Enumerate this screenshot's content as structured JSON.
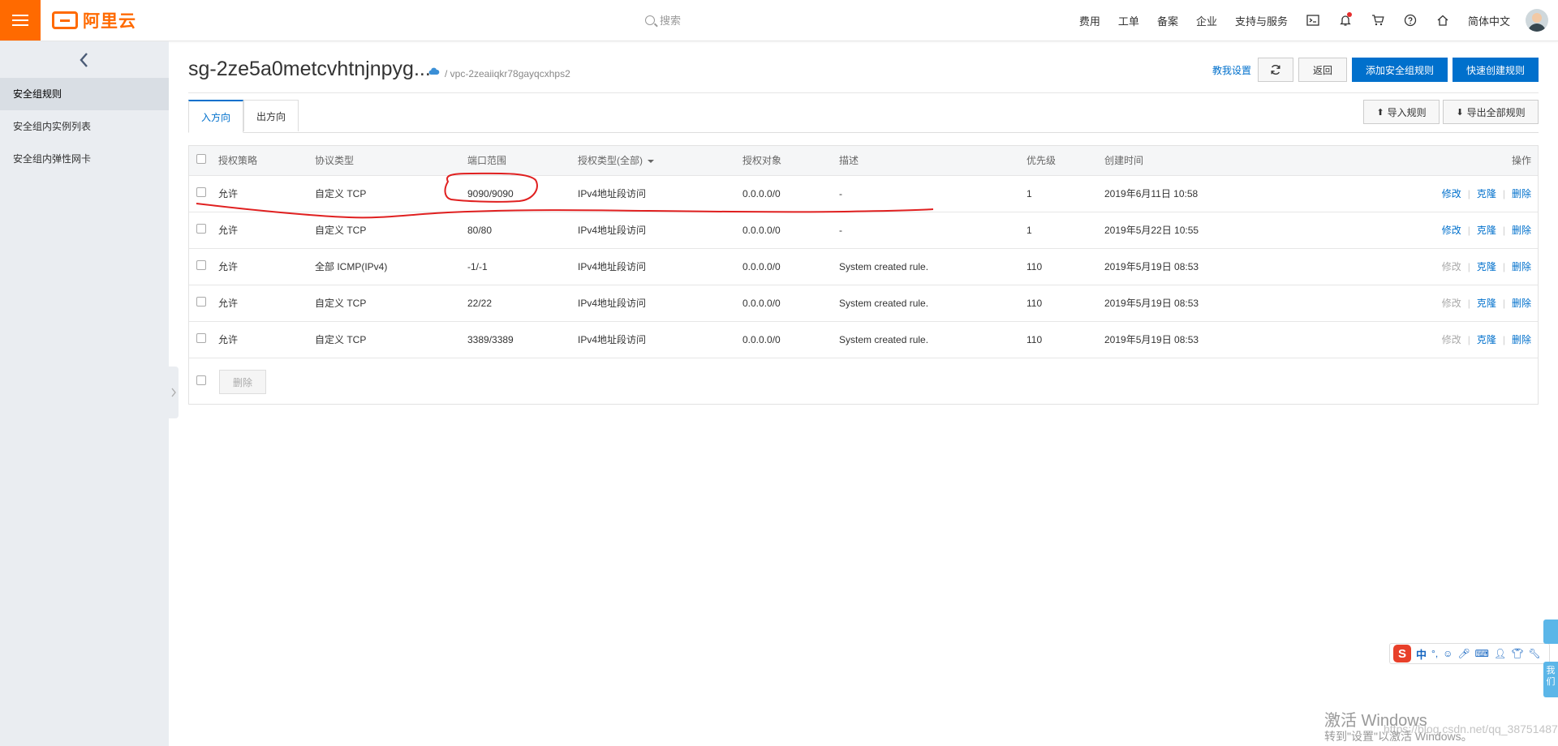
{
  "topbar": {
    "logo_text": "阿里云",
    "search_placeholder": "搜索",
    "nav": [
      "费用",
      "工单",
      "备案",
      "企业",
      "支持与服务"
    ],
    "language": "简体中文",
    "accent_color": "#ff6a00",
    "icons": [
      "terminal-icon",
      "bell-icon",
      "cart-icon",
      "help-icon",
      "home-icon"
    ]
  },
  "sidebar": {
    "items": [
      {
        "label": "安全组规则",
        "active": true
      },
      {
        "label": "安全组内实例列表",
        "active": false
      },
      {
        "label": "安全组内弹性网卡",
        "active": false
      }
    ]
  },
  "header": {
    "title": "sg-2ze5a0metcvhtnjnpyg...",
    "vpc": "/ vpc-2zeaiiqkr78gayqcxhps2",
    "help_link": "教我设置",
    "back_label": "返回",
    "add_rule_label": "添加安全组规则",
    "quick_create_label": "快速创建规则"
  },
  "tabs": {
    "inbound": "入方向",
    "outbound": "出方向",
    "import_label": "导入规则",
    "export_label": "导出全部规则"
  },
  "table": {
    "columns": [
      "授权策略",
      "协议类型",
      "端口范围",
      "授权类型(全部)",
      "授权对象",
      "描述",
      "优先级",
      "创建时间",
      "操作"
    ],
    "rows": [
      {
        "policy": "允许",
        "protocol": "自定义 TCP",
        "port": "9090/9090",
        "auth_type": "IPv4地址段访问",
        "target": "0.0.0.0/0",
        "desc": "-",
        "priority": "1",
        "created": "2019年6月11日 10:58",
        "edit_enabled": true
      },
      {
        "policy": "允许",
        "protocol": "自定义 TCP",
        "port": "80/80",
        "auth_type": "IPv4地址段访问",
        "target": "0.0.0.0/0",
        "desc": "-",
        "priority": "1",
        "created": "2019年5月22日 10:55",
        "edit_enabled": true
      },
      {
        "policy": "允许",
        "protocol": "全部 ICMP(IPv4)",
        "port": "-1/-1",
        "auth_type": "IPv4地址段访问",
        "target": "0.0.0.0/0",
        "desc": "System created rule.",
        "priority": "110",
        "created": "2019年5月19日 08:53",
        "edit_enabled": false
      },
      {
        "policy": "允许",
        "protocol": "自定义 TCP",
        "port": "22/22",
        "auth_type": "IPv4地址段访问",
        "target": "0.0.0.0/0",
        "desc": "System created rule.",
        "priority": "110",
        "created": "2019年5月19日 08:53",
        "edit_enabled": false
      },
      {
        "policy": "允许",
        "protocol": "自定义 TCP",
        "port": "3389/3389",
        "auth_type": "IPv4地址段访问",
        "target": "0.0.0.0/0",
        "desc": "System created rule.",
        "priority": "110",
        "created": "2019年5月19日 08:53",
        "edit_enabled": false
      }
    ],
    "op_edit": "修改",
    "op_clone": "克隆",
    "op_delete": "删除",
    "bulk_delete": "删除"
  },
  "ime": {
    "mode": "中",
    "punct": "°,"
  },
  "side_tabs": {
    "top": "",
    "bottom": "我们"
  },
  "watermark": {
    "line1": "激活 Windows",
    "line2": "转到\"设置\"以激活 Windows。",
    "csdn": "https://blog.csdn.net/qq_38751487"
  }
}
